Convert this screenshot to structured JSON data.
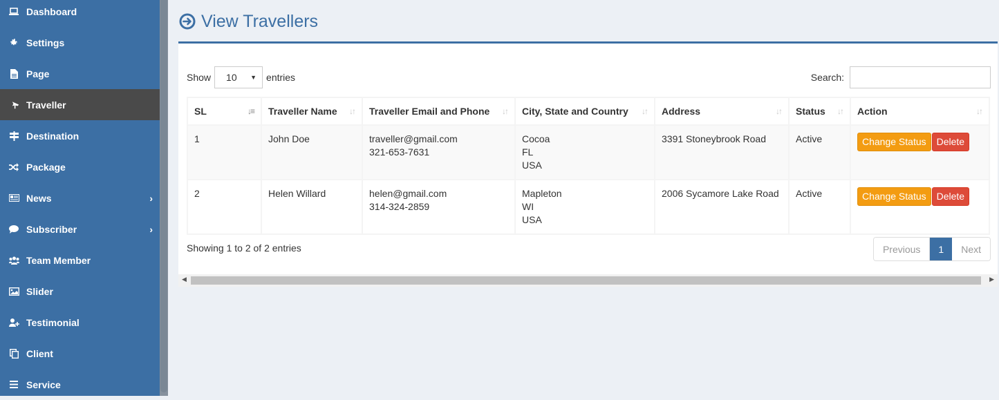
{
  "sidebar": {
    "items": [
      {
        "label": "Dashboard",
        "icon": "laptop-icon",
        "active": false,
        "has_children": false
      },
      {
        "label": "Settings",
        "icon": "gear-icon",
        "active": false,
        "has_children": false
      },
      {
        "label": "Page",
        "icon": "file-icon",
        "active": false,
        "has_children": false
      },
      {
        "label": "Traveller",
        "icon": "plane-icon",
        "active": true,
        "has_children": false
      },
      {
        "label": "Destination",
        "icon": "signpost-icon",
        "active": false,
        "has_children": false
      },
      {
        "label": "Package",
        "icon": "random-icon",
        "active": false,
        "has_children": false
      },
      {
        "label": "News",
        "icon": "newspaper-icon",
        "active": false,
        "has_children": true
      },
      {
        "label": "Subscriber",
        "icon": "comment-icon",
        "active": false,
        "has_children": true
      },
      {
        "label": "Team Member",
        "icon": "users-icon",
        "active": false,
        "has_children": false
      },
      {
        "label": "Slider",
        "icon": "image-icon",
        "active": false,
        "has_children": false
      },
      {
        "label": "Testimonial",
        "icon": "user-plus-icon",
        "active": false,
        "has_children": false
      },
      {
        "label": "Client",
        "icon": "clone-icon",
        "active": false,
        "has_children": false
      },
      {
        "label": "Service",
        "icon": "bars-icon",
        "active": false,
        "has_children": false
      }
    ],
    "chevron": "›"
  },
  "header": {
    "title": "View Travellers",
    "icon": "arrow-circle-right-icon"
  },
  "colors": {
    "primary": "#3c6fa4",
    "active_nav": "#4a4a4a",
    "warning": "#f39c12",
    "danger": "#dd4b39",
    "background": "#ecf0f5"
  },
  "table_controls": {
    "show_label": "Show",
    "entries_label": "entries",
    "page_length": "10",
    "search_label": "Search:",
    "search_value": "",
    "search_placeholder": ""
  },
  "table": {
    "columns": [
      "SL",
      "Traveller Name",
      "Traveller Email and Phone",
      "City, State and Country",
      "Address",
      "Status",
      "Action"
    ],
    "rows": [
      {
        "sl": "1",
        "name": "John Doe",
        "email": "traveller@gmail.com",
        "phone": "321-653-7631",
        "city": "Cocoa",
        "state": "FL",
        "country": "USA",
        "address": "3391 Stoneybrook Road",
        "status": "Active",
        "change_status_label": "Change Status",
        "delete_label": "Delete"
      },
      {
        "sl": "2",
        "name": "Helen Willard",
        "email": "helen@gmail.com",
        "phone": "314-324-2859",
        "city": "Mapleton",
        "state": "WI",
        "country": "USA",
        "address": "2006 Sycamore Lake Road",
        "status": "Active",
        "change_status_label": "Change Status",
        "delete_label": "Delete"
      }
    ]
  },
  "footer": {
    "info": "Showing 1 to 2 of 2 entries",
    "pagination": {
      "previous": "Previous",
      "current": "1",
      "next": "Next"
    }
  }
}
